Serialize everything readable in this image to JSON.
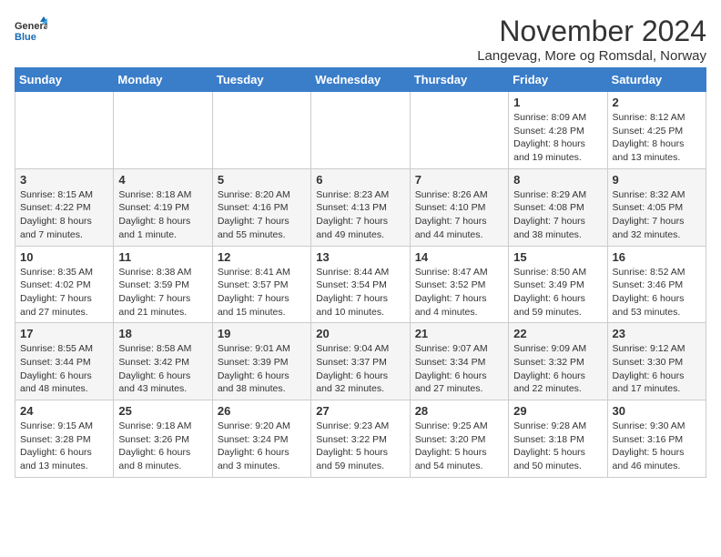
{
  "header": {
    "logo_general": "General",
    "logo_blue": "Blue",
    "month_title": "November 2024",
    "location": "Langevag, More og Romsdal, Norway"
  },
  "weekdays": [
    "Sunday",
    "Monday",
    "Tuesday",
    "Wednesday",
    "Thursday",
    "Friday",
    "Saturday"
  ],
  "weeks": [
    [
      {
        "day": "",
        "info": ""
      },
      {
        "day": "",
        "info": ""
      },
      {
        "day": "",
        "info": ""
      },
      {
        "day": "",
        "info": ""
      },
      {
        "day": "",
        "info": ""
      },
      {
        "day": "1",
        "info": "Sunrise: 8:09 AM\nSunset: 4:28 PM\nDaylight: 8 hours and 19 minutes."
      },
      {
        "day": "2",
        "info": "Sunrise: 8:12 AM\nSunset: 4:25 PM\nDaylight: 8 hours and 13 minutes."
      }
    ],
    [
      {
        "day": "3",
        "info": "Sunrise: 8:15 AM\nSunset: 4:22 PM\nDaylight: 8 hours and 7 minutes."
      },
      {
        "day": "4",
        "info": "Sunrise: 8:18 AM\nSunset: 4:19 PM\nDaylight: 8 hours and 1 minute."
      },
      {
        "day": "5",
        "info": "Sunrise: 8:20 AM\nSunset: 4:16 PM\nDaylight: 7 hours and 55 minutes."
      },
      {
        "day": "6",
        "info": "Sunrise: 8:23 AM\nSunset: 4:13 PM\nDaylight: 7 hours and 49 minutes."
      },
      {
        "day": "7",
        "info": "Sunrise: 8:26 AM\nSunset: 4:10 PM\nDaylight: 7 hours and 44 minutes."
      },
      {
        "day": "8",
        "info": "Sunrise: 8:29 AM\nSunset: 4:08 PM\nDaylight: 7 hours and 38 minutes."
      },
      {
        "day": "9",
        "info": "Sunrise: 8:32 AM\nSunset: 4:05 PM\nDaylight: 7 hours and 32 minutes."
      }
    ],
    [
      {
        "day": "10",
        "info": "Sunrise: 8:35 AM\nSunset: 4:02 PM\nDaylight: 7 hours and 27 minutes."
      },
      {
        "day": "11",
        "info": "Sunrise: 8:38 AM\nSunset: 3:59 PM\nDaylight: 7 hours and 21 minutes."
      },
      {
        "day": "12",
        "info": "Sunrise: 8:41 AM\nSunset: 3:57 PM\nDaylight: 7 hours and 15 minutes."
      },
      {
        "day": "13",
        "info": "Sunrise: 8:44 AM\nSunset: 3:54 PM\nDaylight: 7 hours and 10 minutes."
      },
      {
        "day": "14",
        "info": "Sunrise: 8:47 AM\nSunset: 3:52 PM\nDaylight: 7 hours and 4 minutes."
      },
      {
        "day": "15",
        "info": "Sunrise: 8:50 AM\nSunset: 3:49 PM\nDaylight: 6 hours and 59 minutes."
      },
      {
        "day": "16",
        "info": "Sunrise: 8:52 AM\nSunset: 3:46 PM\nDaylight: 6 hours and 53 minutes."
      }
    ],
    [
      {
        "day": "17",
        "info": "Sunrise: 8:55 AM\nSunset: 3:44 PM\nDaylight: 6 hours and 48 minutes."
      },
      {
        "day": "18",
        "info": "Sunrise: 8:58 AM\nSunset: 3:42 PM\nDaylight: 6 hours and 43 minutes."
      },
      {
        "day": "19",
        "info": "Sunrise: 9:01 AM\nSunset: 3:39 PM\nDaylight: 6 hours and 38 minutes."
      },
      {
        "day": "20",
        "info": "Sunrise: 9:04 AM\nSunset: 3:37 PM\nDaylight: 6 hours and 32 minutes."
      },
      {
        "day": "21",
        "info": "Sunrise: 9:07 AM\nSunset: 3:34 PM\nDaylight: 6 hours and 27 minutes."
      },
      {
        "day": "22",
        "info": "Sunrise: 9:09 AM\nSunset: 3:32 PM\nDaylight: 6 hours and 22 minutes."
      },
      {
        "day": "23",
        "info": "Sunrise: 9:12 AM\nSunset: 3:30 PM\nDaylight: 6 hours and 17 minutes."
      }
    ],
    [
      {
        "day": "24",
        "info": "Sunrise: 9:15 AM\nSunset: 3:28 PM\nDaylight: 6 hours and 13 minutes."
      },
      {
        "day": "25",
        "info": "Sunrise: 9:18 AM\nSunset: 3:26 PM\nDaylight: 6 hours and 8 minutes."
      },
      {
        "day": "26",
        "info": "Sunrise: 9:20 AM\nSunset: 3:24 PM\nDaylight: 6 hours and 3 minutes."
      },
      {
        "day": "27",
        "info": "Sunrise: 9:23 AM\nSunset: 3:22 PM\nDaylight: 5 hours and 59 minutes."
      },
      {
        "day": "28",
        "info": "Sunrise: 9:25 AM\nSunset: 3:20 PM\nDaylight: 5 hours and 54 minutes."
      },
      {
        "day": "29",
        "info": "Sunrise: 9:28 AM\nSunset: 3:18 PM\nDaylight: 5 hours and 50 minutes."
      },
      {
        "day": "30",
        "info": "Sunrise: 9:30 AM\nSunset: 3:16 PM\nDaylight: 5 hours and 46 minutes."
      }
    ]
  ]
}
